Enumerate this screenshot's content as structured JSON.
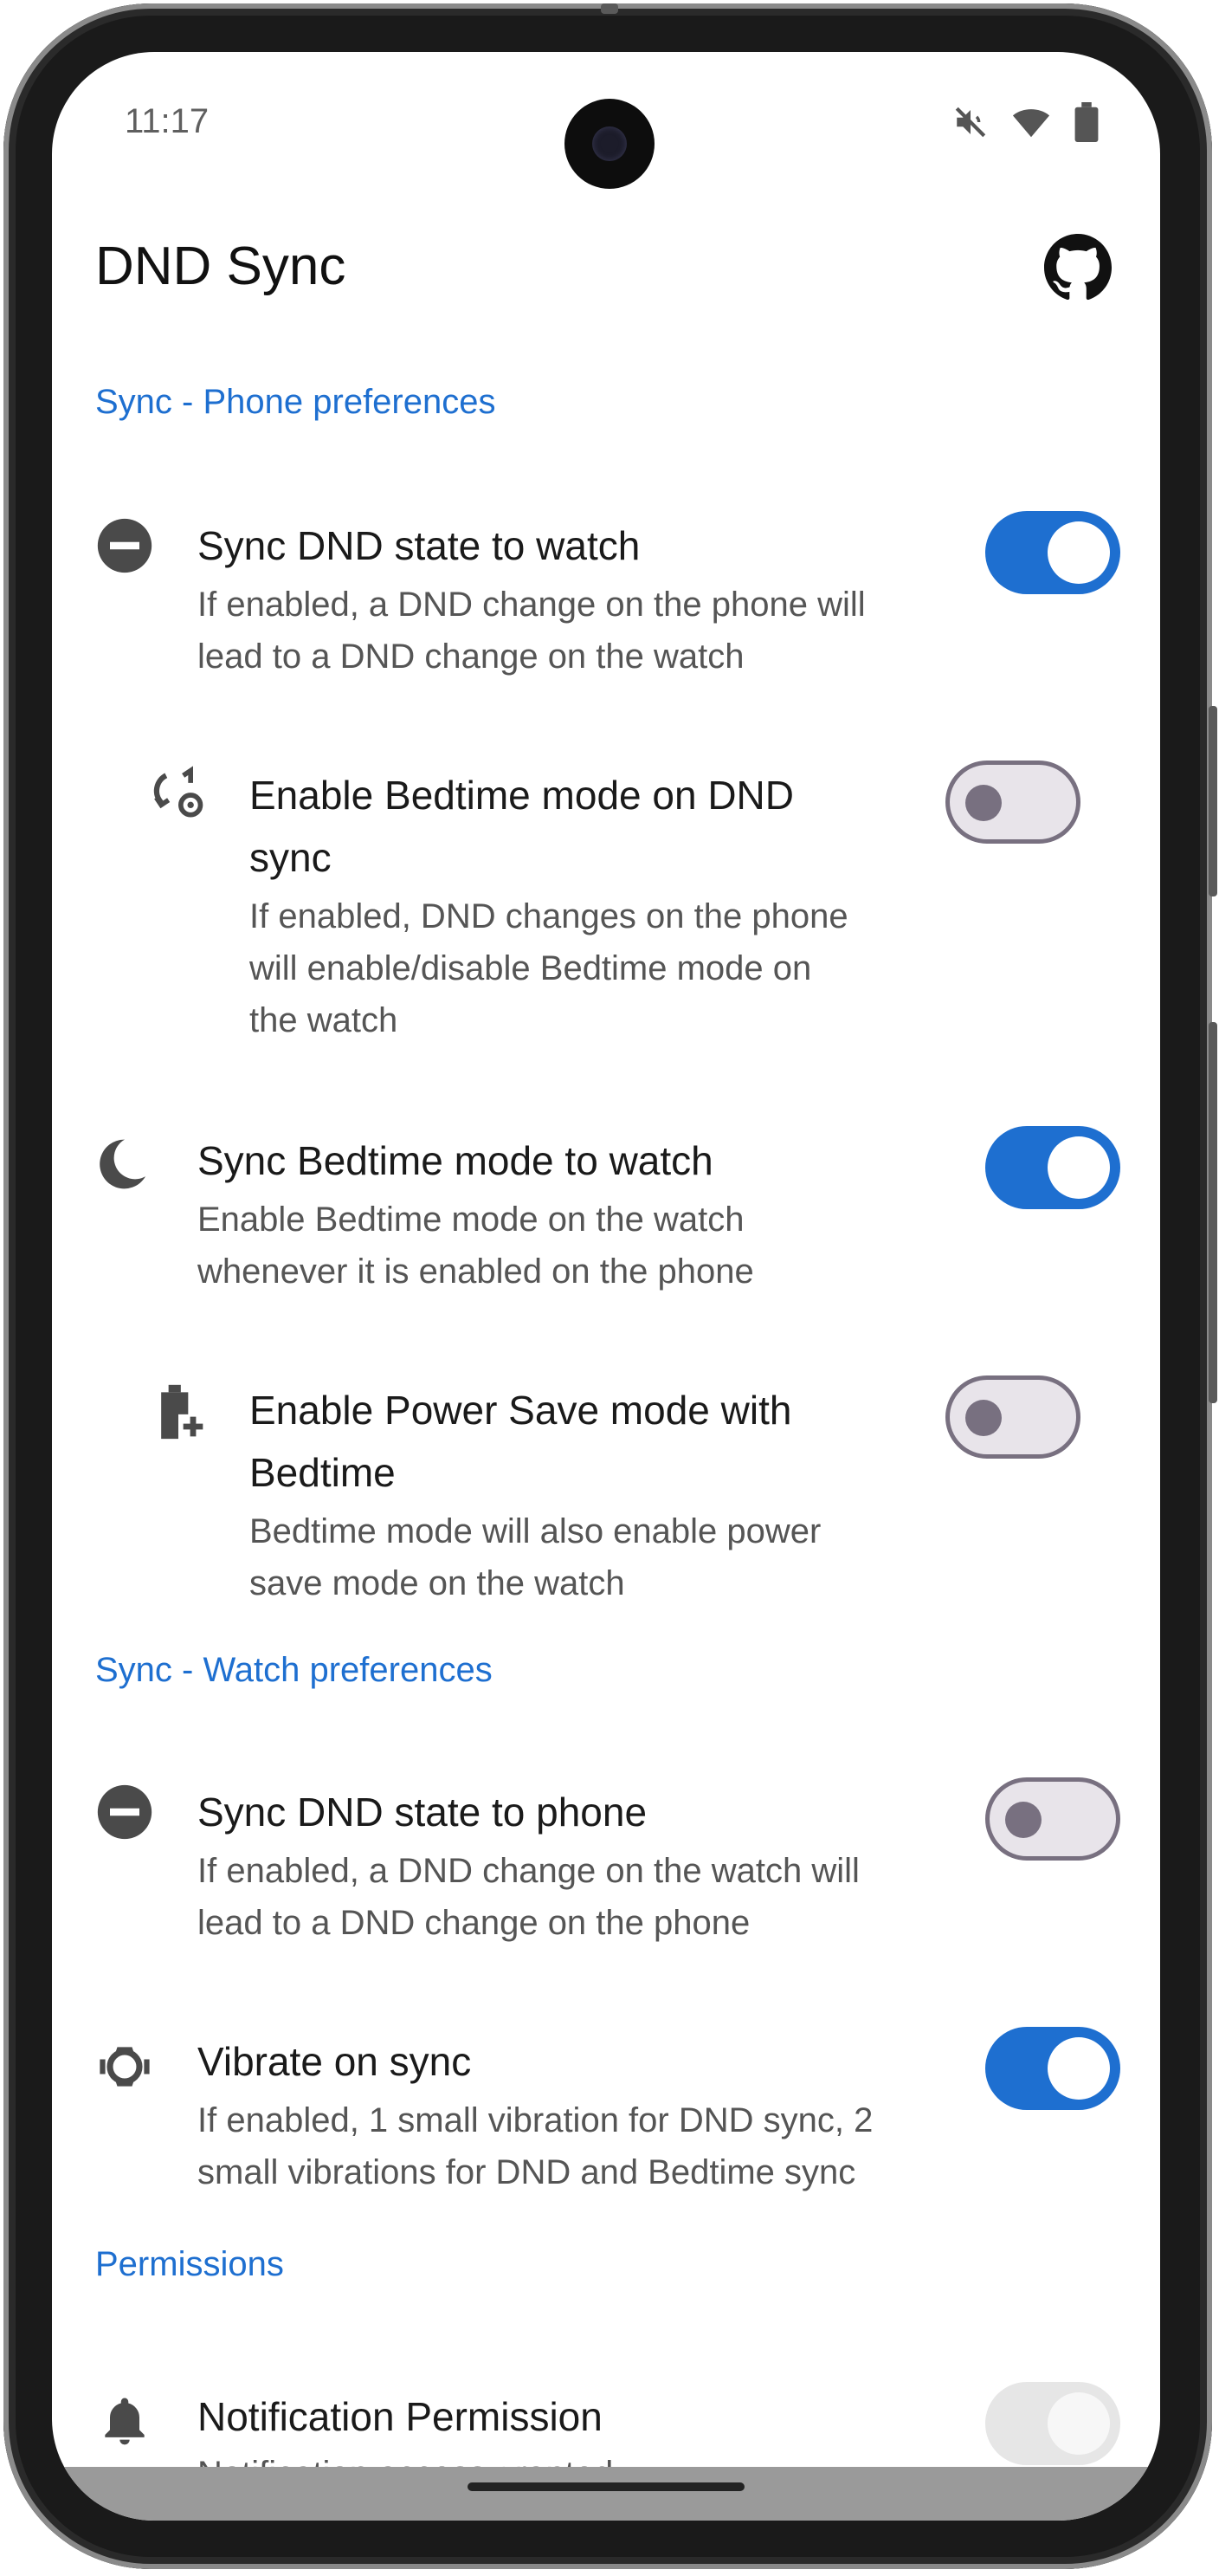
{
  "status": {
    "time": "11:17"
  },
  "app": {
    "title": "DND Sync"
  },
  "sections": {
    "phone": "Sync - Phone preferences",
    "watch": "Sync - Watch preferences",
    "permissions": "Permissions"
  },
  "rows": {
    "sync_dnd_watch": {
      "title": "Sync DND state to watch",
      "sub1": "If enabled, a DND change on the phone will",
      "sub2": "lead to a DND change on the watch",
      "enabled": true
    },
    "bedtime_on_dnd": {
      "title1": "Enable Bedtime mode on DND",
      "title2": "sync",
      "sub1": "If enabled, DND changes on the phone",
      "sub2": "will enable/disable Bedtime mode on",
      "sub3": "the watch",
      "enabled": false
    },
    "sync_bedtime": {
      "title": "Sync Bedtime mode to watch",
      "sub1": "Enable Bedtime mode on the watch",
      "sub2": "whenever it is enabled on the phone",
      "enabled": true
    },
    "power_save": {
      "title1": "Enable Power Save mode with",
      "title2": "Bedtime",
      "sub1": "Bedtime mode will also enable power",
      "sub2": "save mode on the watch",
      "enabled": false
    },
    "sync_dnd_phone": {
      "title": "Sync DND state to phone",
      "sub1": "If enabled, a DND change on the watch will",
      "sub2": "lead to a DND change on the phone",
      "enabled": false
    },
    "vibrate": {
      "title": "Vibrate on sync",
      "sub1": "If enabled, 1 small vibration for DND sync, 2",
      "sub2": "small vibrations for DND and Bedtime sync",
      "enabled": true
    },
    "notification": {
      "title": "Notification Permission",
      "sub1": "Notification access granted",
      "enabled": true,
      "disabled": true
    }
  },
  "icons": {
    "dnd": "minus-circle-icon",
    "bedtime_sync": "sync-settings-icon",
    "bedtime": "moon-icon",
    "power": "battery-plus-icon",
    "vibrate": "watch-vibrate-icon",
    "bell": "bell-icon",
    "github": "github-icon"
  },
  "colors": {
    "accent": "#1e6fd0",
    "toggle_off_border": "#787080"
  }
}
